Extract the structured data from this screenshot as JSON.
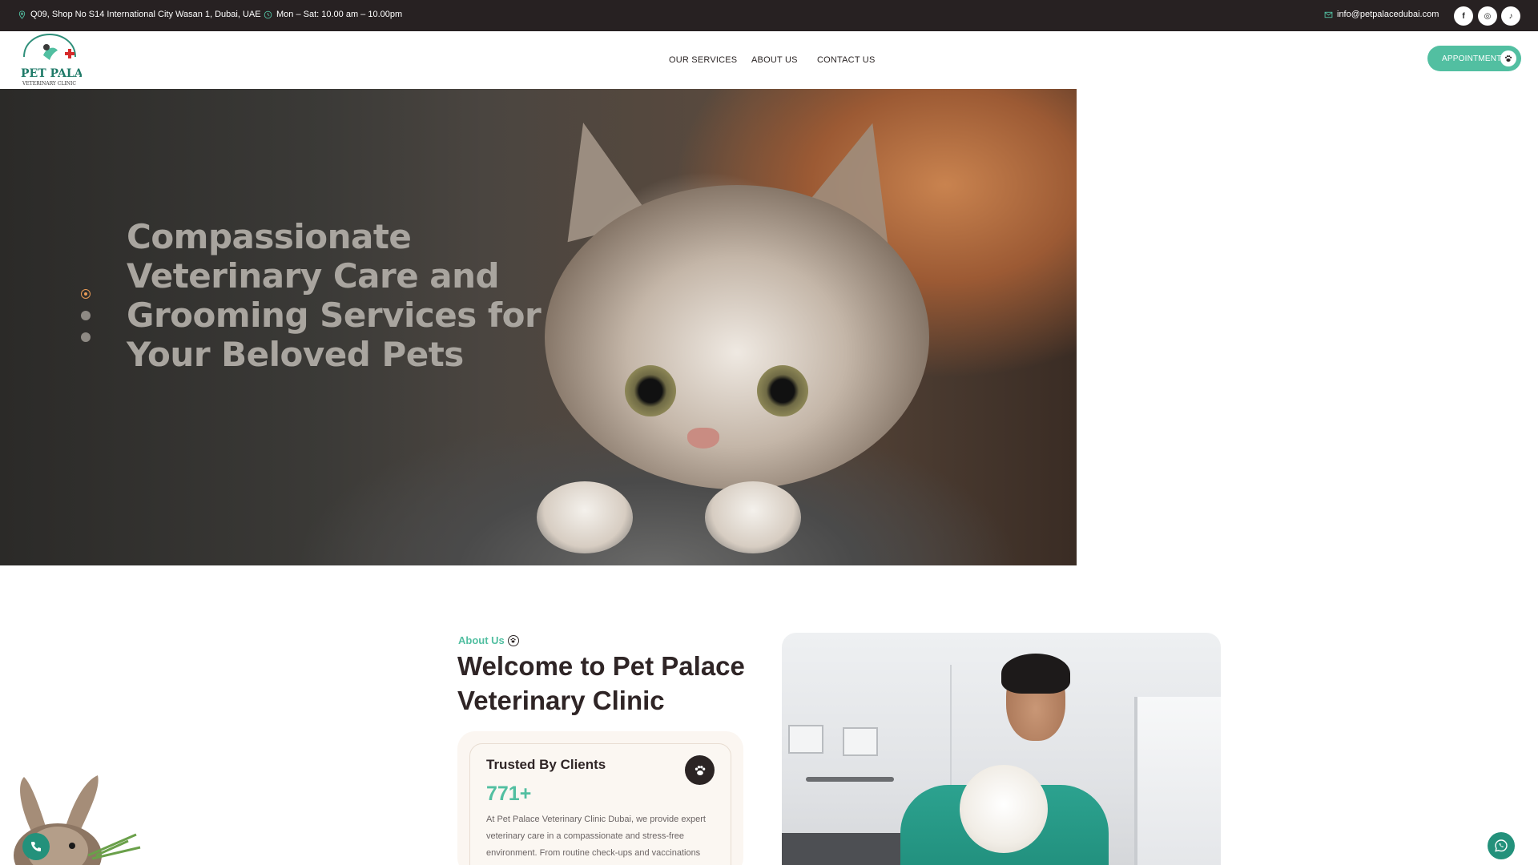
{
  "topbar": {
    "address": "Q09, Shop No S14 International City Wasan 1, Dubai, UAE",
    "hours": "Mon – Sat: 10.00 am – 10.00pm",
    "email": "info@petpalacedubai.com",
    "social": [
      {
        "icon": "facebook-icon",
        "glyph": "f"
      },
      {
        "icon": "instagram-icon",
        "glyph": "◎"
      },
      {
        "icon": "tiktok-icon",
        "glyph": "♪"
      }
    ]
  },
  "header": {
    "logo": {
      "line1": "PET PALACE",
      "line2": "VETERINARY CLINIC"
    },
    "nav": [
      "OUR SERVICES",
      "ABOUT US",
      "CONTACT US"
    ],
    "appointment_label": "APPOINTMENT"
  },
  "hero": {
    "title": "Compassionate Veterinary Care and Grooming Services for Your Beloved Pets",
    "slides_count": 3,
    "active_slide": 1
  },
  "about": {
    "label": "About Us",
    "heading": "Welcome to Pet Palace Veterinary Clinic",
    "card": {
      "title": "Trusted By Clients",
      "number": "771+",
      "text": "At Pet Palace Veterinary Clinic Dubai, we provide expert veterinary care in a compassionate and stress-free environment. From routine check-ups and vaccinations"
    }
  },
  "colors": {
    "accent": "#52bfa1",
    "dark": "#272122",
    "slider_active": "#e99b56",
    "fab": "#23917b"
  }
}
